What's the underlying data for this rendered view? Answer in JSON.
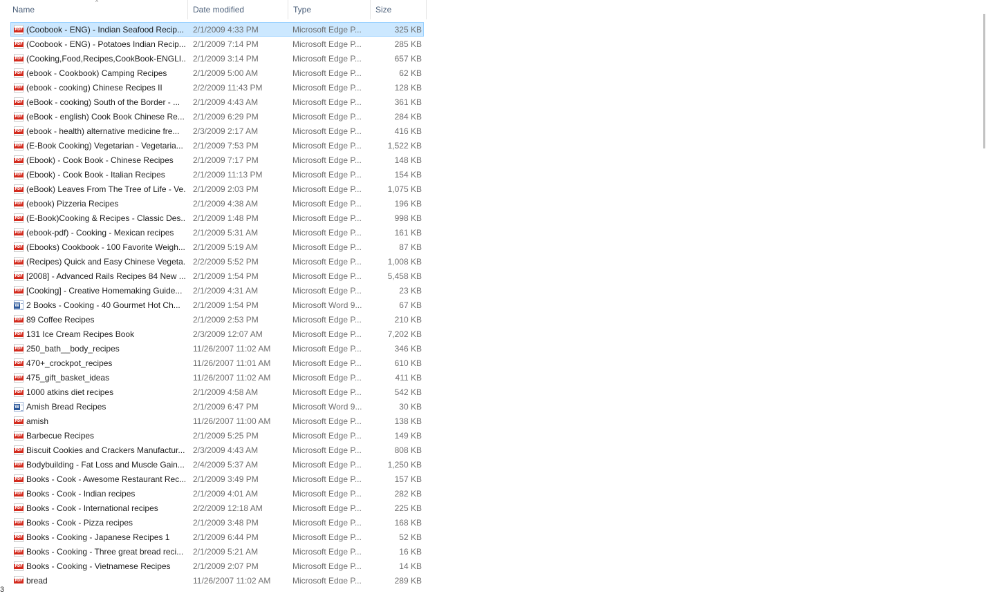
{
  "columns": {
    "name": "Name",
    "date": "Date modified",
    "type": "Type",
    "size": "Size"
  },
  "files": [
    {
      "icon": "pdf-icon",
      "name": "(Coobook - ENG) - Indian Seafood Recip...",
      "date": "2/1/2009 4:33 PM",
      "type": "Microsoft Edge P...",
      "size": "325 KB",
      "selected": true
    },
    {
      "icon": "pdf-icon",
      "name": "(Coobook - ENG) - Potatoes Indian Recip...",
      "date": "2/1/2009 7:14 PM",
      "type": "Microsoft Edge P...",
      "size": "285 KB"
    },
    {
      "icon": "pdf-icon",
      "name": "(Cooking,Food,Recipes,CookBook-ENGLI...",
      "date": "2/1/2009 3:14 PM",
      "type": "Microsoft Edge P...",
      "size": "657 KB"
    },
    {
      "icon": "pdf-icon",
      "name": "(ebook - Cookbook) Camping Recipes",
      "date": "2/1/2009 5:00 AM",
      "type": "Microsoft Edge P...",
      "size": "62 KB"
    },
    {
      "icon": "pdf-icon",
      "name": "(ebook - cooking) Chinese Recipes II",
      "date": "2/2/2009 11:43 PM",
      "type": "Microsoft Edge P...",
      "size": "128 KB"
    },
    {
      "icon": "pdf-icon",
      "name": "(eBook - cooking) South of the Border - ...",
      "date": "2/1/2009 4:43 AM",
      "type": "Microsoft Edge P...",
      "size": "361 KB"
    },
    {
      "icon": "pdf-icon",
      "name": "(eBook - english) Cook Book Chinese Re...",
      "date": "2/1/2009 6:29 PM",
      "type": "Microsoft Edge P...",
      "size": "284 KB"
    },
    {
      "icon": "pdf-icon",
      "name": "(ebook - health) alternative medicine fre...",
      "date": "2/3/2009 2:17 AM",
      "type": "Microsoft Edge P...",
      "size": "416 KB"
    },
    {
      "icon": "pdf-icon",
      "name": "(E-Book Cooking) Vegetarian - Vegetaria...",
      "date": "2/1/2009 7:53 PM",
      "type": "Microsoft Edge P...",
      "size": "1,522 KB"
    },
    {
      "icon": "pdf-icon",
      "name": "(Ebook) - Cook Book - Chinese Recipes",
      "date": "2/1/2009 7:17 PM",
      "type": "Microsoft Edge P...",
      "size": "148 KB"
    },
    {
      "icon": "pdf-icon",
      "name": "(Ebook) - Cook Book - Italian Recipes",
      "date": "2/1/2009 11:13 PM",
      "type": "Microsoft Edge P...",
      "size": "154 KB"
    },
    {
      "icon": "pdf-icon",
      "name": "(eBook) Leaves From The Tree of Life - Ve...",
      "date": "2/1/2009 2:03 PM",
      "type": "Microsoft Edge P...",
      "size": "1,075 KB"
    },
    {
      "icon": "pdf-icon",
      "name": "(ebook) Pizzeria Recipes",
      "date": "2/1/2009 4:38 AM",
      "type": "Microsoft Edge P...",
      "size": "196 KB"
    },
    {
      "icon": "pdf-icon",
      "name": "(E-Book)Cooking & Recipes - Classic Des...",
      "date": "2/1/2009 1:48 PM",
      "type": "Microsoft Edge P...",
      "size": "998 KB"
    },
    {
      "icon": "pdf-icon",
      "name": "(ebook-pdf) - Cooking - Mexican recipes",
      "date": "2/1/2009 5:31 AM",
      "type": "Microsoft Edge P...",
      "size": "161 KB"
    },
    {
      "icon": "pdf-icon",
      "name": "(Ebooks) Cookbook - 100 Favorite Weigh...",
      "date": "2/1/2009 5:19 AM",
      "type": "Microsoft Edge P...",
      "size": "87 KB"
    },
    {
      "icon": "pdf-icon",
      "name": "(Recipes) Quick and Easy Chinese Vegeta...",
      "date": "2/2/2009 5:52 PM",
      "type": "Microsoft Edge P...",
      "size": "1,008 KB"
    },
    {
      "icon": "pdf-icon",
      "name": "[2008] - Advanced Rails Recipes 84 New ...",
      "date": "2/1/2009 1:54 PM",
      "type": "Microsoft Edge P...",
      "size": "5,458 KB"
    },
    {
      "icon": "pdf-icon",
      "name": "[Cooking] - Creative Homemaking Guide...",
      "date": "2/1/2009 4:31 AM",
      "type": "Microsoft Edge P...",
      "size": "23 KB"
    },
    {
      "icon": "word-icon",
      "name": "2 Books - Cooking - 40 Gourmet Hot Ch...",
      "date": "2/1/2009 1:54 PM",
      "type": "Microsoft Word 9...",
      "size": "67 KB"
    },
    {
      "icon": "pdf-icon",
      "name": "89 Coffee Recipes",
      "date": "2/1/2009 2:53 PM",
      "type": "Microsoft Edge P...",
      "size": "210 KB"
    },
    {
      "icon": "pdf-icon",
      "name": "131 Ice Cream Recipes Book",
      "date": "2/3/2009 12:07 AM",
      "type": "Microsoft Edge P...",
      "size": "7,202 KB"
    },
    {
      "icon": "pdf-icon",
      "name": "250_bath__body_recipes",
      "date": "11/26/2007 11:02 AM",
      "type": "Microsoft Edge P...",
      "size": "346 KB"
    },
    {
      "icon": "pdf-icon",
      "name": "470+_crockpot_recipes",
      "date": "11/26/2007 11:01 AM",
      "type": "Microsoft Edge P...",
      "size": "610 KB"
    },
    {
      "icon": "pdf-icon",
      "name": "475_gift_basket_ideas",
      "date": "11/26/2007 11:02 AM",
      "type": "Microsoft Edge P...",
      "size": "411 KB"
    },
    {
      "icon": "pdf-icon",
      "name": "1000 atkins diet recipes",
      "date": "2/1/2009 4:58 AM",
      "type": "Microsoft Edge P...",
      "size": "542 KB"
    },
    {
      "icon": "word-icon",
      "name": "Amish Bread Recipes",
      "date": "2/1/2009 6:47 PM",
      "type": "Microsoft Word 9...",
      "size": "30 KB"
    },
    {
      "icon": "pdf-icon",
      "name": "amish",
      "date": "11/26/2007 11:00 AM",
      "type": "Microsoft Edge P...",
      "size": "138 KB"
    },
    {
      "icon": "pdf-icon",
      "name": "Barbecue Recipes",
      "date": "2/1/2009 5:25 PM",
      "type": "Microsoft Edge P...",
      "size": "149 KB"
    },
    {
      "icon": "pdf-icon",
      "name": "Biscuit Cookies and Crackers Manufactur...",
      "date": "2/3/2009 4:43 AM",
      "type": "Microsoft Edge P...",
      "size": "808 KB"
    },
    {
      "icon": "pdf-icon",
      "name": "Bodybuilding - Fat Loss and Muscle Gain...",
      "date": "2/4/2009 5:37 AM",
      "type": "Microsoft Edge P...",
      "size": "1,250 KB"
    },
    {
      "icon": "pdf-icon",
      "name": "Books - Cook - Awesome Restaurant Rec...",
      "date": "2/1/2009 3:49 PM",
      "type": "Microsoft Edge P...",
      "size": "157 KB"
    },
    {
      "icon": "pdf-icon",
      "name": "Books - Cook - Indian recipes",
      "date": "2/1/2009 4:01 AM",
      "type": "Microsoft Edge P...",
      "size": "282 KB"
    },
    {
      "icon": "pdf-icon",
      "name": "Books - Cook - International recipes",
      "date": "2/2/2009 12:18 AM",
      "type": "Microsoft Edge P...",
      "size": "225 KB"
    },
    {
      "icon": "pdf-icon",
      "name": "Books - Cook - Pizza recipes",
      "date": "2/1/2009 3:48 PM",
      "type": "Microsoft Edge P...",
      "size": "168 KB"
    },
    {
      "icon": "pdf-icon",
      "name": "Books - Cooking - Japanese Recipes 1",
      "date": "2/1/2009 6:44 PM",
      "type": "Microsoft Edge P...",
      "size": "52 KB"
    },
    {
      "icon": "pdf-icon",
      "name": "Books - Cooking - Three great bread reci...",
      "date": "2/1/2009 5:21 AM",
      "type": "Microsoft Edge P...",
      "size": "16 KB"
    },
    {
      "icon": "pdf-icon",
      "name": "Books - Cooking - Vietnamese Recipes",
      "date": "2/1/2009 2:07 PM",
      "type": "Microsoft Edge P...",
      "size": "14 KB"
    },
    {
      "icon": "pdf-icon",
      "name": "bread",
      "date": "11/26/2007 11:02 AM",
      "type": "Microsoft Edge P...",
      "size": "289 KB"
    }
  ],
  "status_fragment": "3",
  "icons": {
    "sort": "chevron-up-icon",
    "pdf_label": "PDF",
    "word_label": "W"
  }
}
